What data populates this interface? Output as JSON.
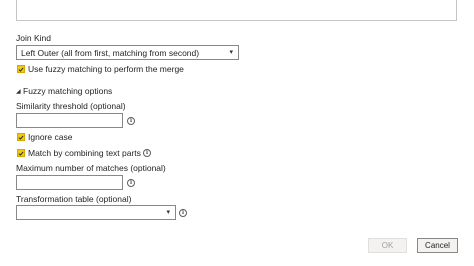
{
  "join_kind": {
    "label": "Join Kind",
    "selected": "Left Outer (all from first, matching from second)"
  },
  "fuzzy": {
    "use_fuzzy_label": "Use fuzzy matching to perform the merge",
    "use_fuzzy_checked": true,
    "options_header": "Fuzzy matching options",
    "similarity_label": "Similarity threshold (optional)",
    "similarity_value": "",
    "ignore_case_label": "Ignore case",
    "ignore_case_checked": true,
    "combine_parts_label": "Match by combining text parts",
    "combine_parts_checked": true,
    "max_matches_label": "Maximum number of matches (optional)",
    "max_matches_value": "",
    "transform_label": "Transformation table (optional)",
    "transform_selected": ""
  },
  "buttons": {
    "ok": "OK",
    "cancel": "Cancel"
  },
  "icons": {
    "info": "info-icon",
    "check": "checkmark-icon",
    "expander": "collapse-triangle-icon",
    "dropdown": "chevron-down-icon"
  },
  "colors": {
    "checkbox": "#f2c811",
    "border": "#8a8886"
  }
}
